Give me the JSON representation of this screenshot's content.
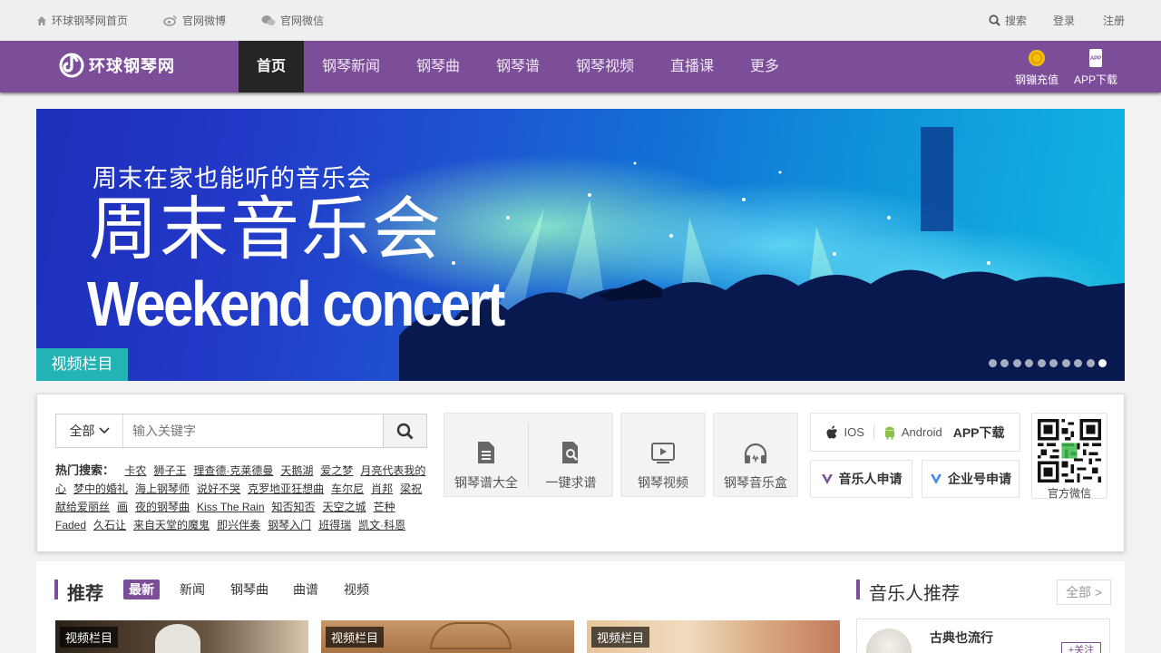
{
  "topbar": {
    "home": "环球钢琴网首页",
    "weibo": "官网微博",
    "wechat": "官网微信",
    "search": "搜索",
    "login": "登录",
    "register": "注册"
  },
  "nav": {
    "logo": "环球钢琴网",
    "items": [
      "首页",
      "钢琴新闻",
      "钢琴曲",
      "钢琴谱",
      "钢琴视频",
      "直播课",
      "更多"
    ],
    "recharge": "钢镚充值",
    "app": "APP下载",
    "app_badge": "APP"
  },
  "banner": {
    "subtitle": "周末在家也能听的音乐会",
    "title_cn": "周末音乐会",
    "title_en": "Weekend concert",
    "tag": "视频栏目",
    "dot_count": 10,
    "active_dot": 9
  },
  "search": {
    "category": "全部",
    "placeholder": "输入关键字",
    "hot_label": "热门搜索：",
    "hot_terms": [
      "卡农",
      "狮子王",
      "理查德·克莱德曼",
      "天鹅湖",
      "爱之梦",
      "月亮代表我的心",
      "梦中的婚礼",
      "海上钢琴师",
      "说好不哭",
      "克罗地亚狂想曲",
      "车尔尼",
      "肖邦",
      "梁祝",
      "献给爱丽丝",
      "画",
      "夜的钢琴曲",
      "Kiss The Rain",
      "知否知否",
      "天空之城",
      "芒种",
      "Faded",
      "久石让",
      "来自天堂的魔鬼",
      "即兴伴奏",
      "钢琴入门",
      "班得瑞",
      "凯文·科恩"
    ]
  },
  "tools": {
    "sheets": "钢琴谱大全",
    "request": "一键求谱",
    "videos": "钢琴视频",
    "musicbox": "钢琴音乐盒"
  },
  "apps": {
    "ios": "IOS",
    "android": "Android",
    "download": "APP下载",
    "musician_apply": "音乐人申请",
    "company_apply": "企业号申请",
    "qr_label": "官方微信"
  },
  "recommend": {
    "title": "推荐",
    "tabs": [
      "最新",
      "新闻",
      "钢琴曲",
      "曲谱",
      "视频"
    ],
    "thumbs": [
      "视频栏目",
      "视频栏目",
      "视频栏目"
    ]
  },
  "musicians": {
    "title": "音乐人推荐",
    "all": "全部 >",
    "first_name": "古典也流行",
    "follow": "+关注"
  },
  "colors": {
    "brand": "#7c4d98",
    "teal_tag": "#23b3b4",
    "nav_active": "#252525"
  }
}
